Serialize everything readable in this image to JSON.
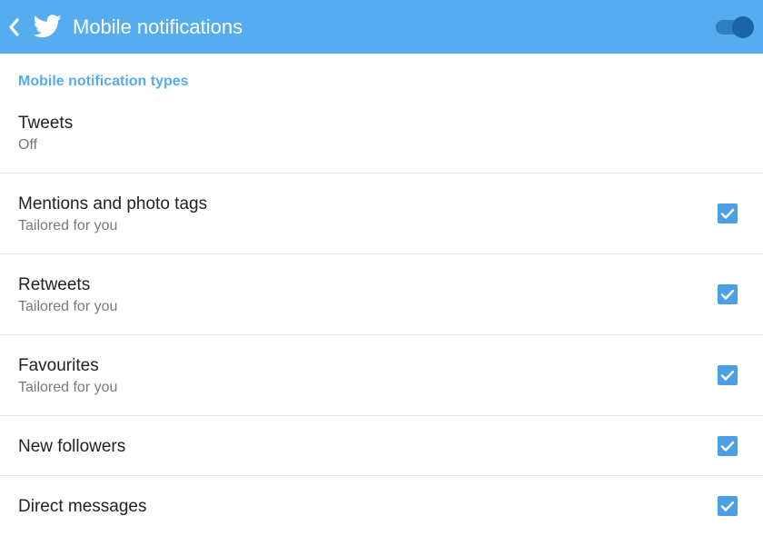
{
  "appbar": {
    "title": "Mobile notifications",
    "back_icon": "chevron-left-icon",
    "logo_icon": "twitter-bird-icon",
    "master_toggle": {
      "state": "on",
      "color": "#1a64a8"
    },
    "background_color": "#55acee"
  },
  "section": {
    "header": "Mobile notification types",
    "header_color": "#55acee"
  },
  "items": [
    {
      "title": "Tweets",
      "subtitle": "Off",
      "checked": null
    },
    {
      "title": "Mentions and photo tags",
      "subtitle": "Tailored for you",
      "checked": true
    },
    {
      "title": "Retweets",
      "subtitle": "Tailored for you",
      "checked": true
    },
    {
      "title": "Favourites",
      "subtitle": "Tailored for you",
      "checked": true
    },
    {
      "title": "New followers",
      "subtitle": "",
      "checked": true
    },
    {
      "title": "Direct messages",
      "subtitle": "",
      "checked": true
    }
  ],
  "checkbox_color": "#4a9fe6"
}
